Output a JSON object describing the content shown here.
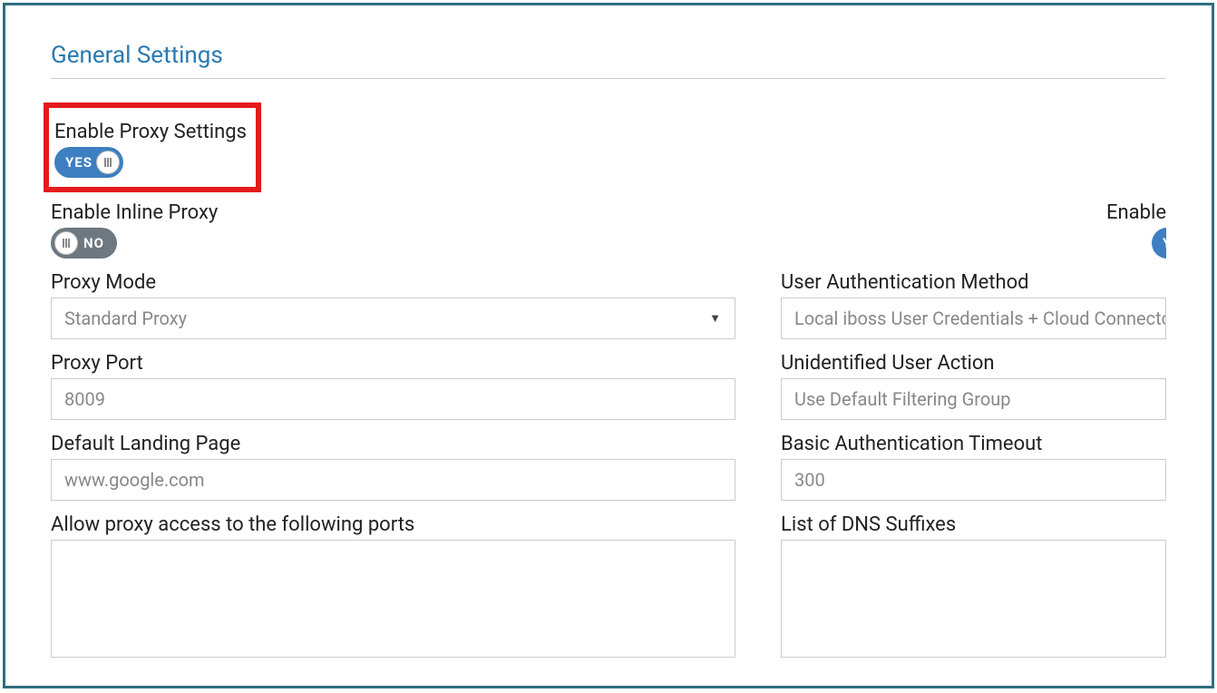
{
  "section_title": "General Settings",
  "enable_proxy_settings": {
    "label": "Enable Proxy Settings",
    "state": "on",
    "text": "YES"
  },
  "enable_inline_proxy": {
    "label": "Enable Inline Proxy",
    "state": "off",
    "text": "NO"
  },
  "enable_right_cutoff": {
    "label": "Enable",
    "state": "on",
    "text": "YES"
  },
  "left": {
    "proxy_mode": {
      "label": "Proxy Mode",
      "value": "Standard Proxy"
    },
    "proxy_port": {
      "label": "Proxy Port",
      "value": "8009"
    },
    "default_landing": {
      "label": "Default Landing Page",
      "value": "www.google.com"
    },
    "allow_ports": {
      "label": "Allow proxy access to the following ports",
      "value": ""
    }
  },
  "right": {
    "auth_method": {
      "label": "User Authentication Method",
      "value": "Local iboss User Credentials + Cloud Connectors"
    },
    "unidentified_action": {
      "label": "Unidentified User Action",
      "value": "Use Default Filtering Group"
    },
    "basic_auth_timeout": {
      "label": "Basic Authentication Timeout",
      "value": "300"
    },
    "dns_suffixes": {
      "label": "List of DNS Suffixes",
      "value": ""
    }
  }
}
